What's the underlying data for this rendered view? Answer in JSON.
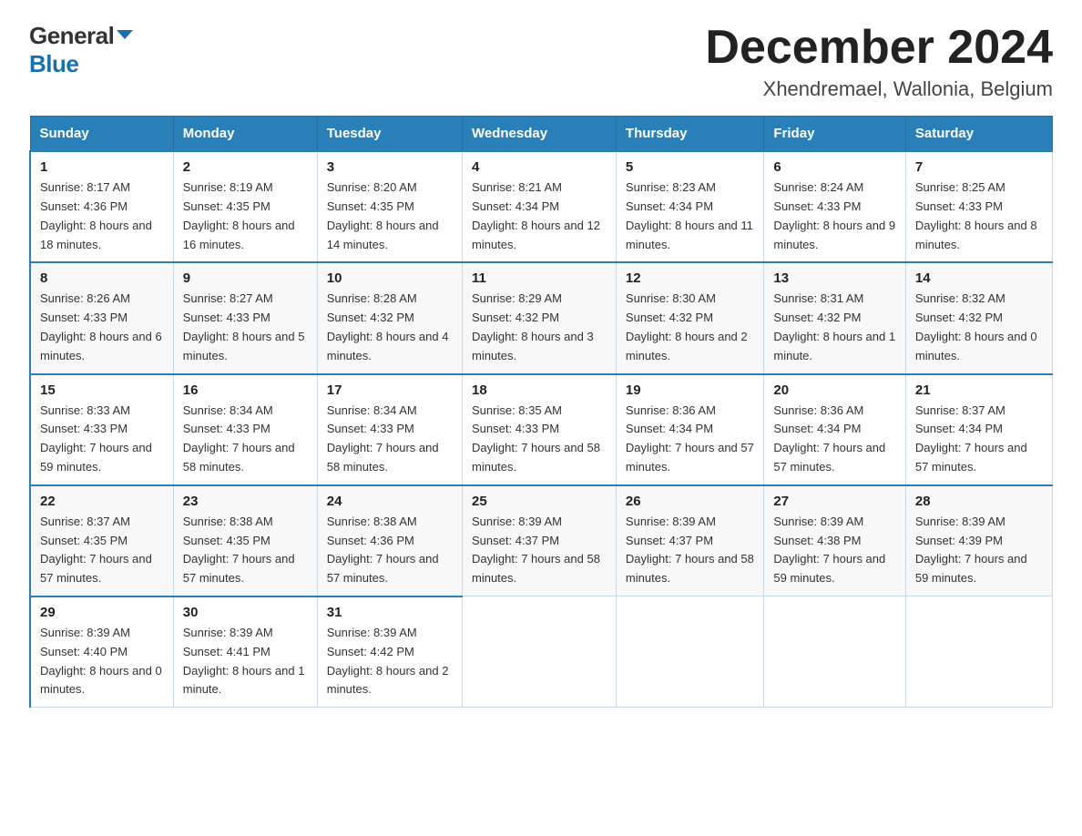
{
  "header": {
    "logo_general": "General",
    "logo_blue": "Blue",
    "month_title": "December 2024",
    "location": "Xhendremael, Wallonia, Belgium"
  },
  "columns": [
    "Sunday",
    "Monday",
    "Tuesday",
    "Wednesday",
    "Thursday",
    "Friday",
    "Saturday"
  ],
  "weeks": [
    [
      {
        "day": "1",
        "sunrise": "Sunrise: 8:17 AM",
        "sunset": "Sunset: 4:36 PM",
        "daylight": "Daylight: 8 hours and 18 minutes."
      },
      {
        "day": "2",
        "sunrise": "Sunrise: 8:19 AM",
        "sunset": "Sunset: 4:35 PM",
        "daylight": "Daylight: 8 hours and 16 minutes."
      },
      {
        "day": "3",
        "sunrise": "Sunrise: 8:20 AM",
        "sunset": "Sunset: 4:35 PM",
        "daylight": "Daylight: 8 hours and 14 minutes."
      },
      {
        "day": "4",
        "sunrise": "Sunrise: 8:21 AM",
        "sunset": "Sunset: 4:34 PM",
        "daylight": "Daylight: 8 hours and 12 minutes."
      },
      {
        "day": "5",
        "sunrise": "Sunrise: 8:23 AM",
        "sunset": "Sunset: 4:34 PM",
        "daylight": "Daylight: 8 hours and 11 minutes."
      },
      {
        "day": "6",
        "sunrise": "Sunrise: 8:24 AM",
        "sunset": "Sunset: 4:33 PM",
        "daylight": "Daylight: 8 hours and 9 minutes."
      },
      {
        "day": "7",
        "sunrise": "Sunrise: 8:25 AM",
        "sunset": "Sunset: 4:33 PM",
        "daylight": "Daylight: 8 hours and 8 minutes."
      }
    ],
    [
      {
        "day": "8",
        "sunrise": "Sunrise: 8:26 AM",
        "sunset": "Sunset: 4:33 PM",
        "daylight": "Daylight: 8 hours and 6 minutes."
      },
      {
        "day": "9",
        "sunrise": "Sunrise: 8:27 AM",
        "sunset": "Sunset: 4:33 PM",
        "daylight": "Daylight: 8 hours and 5 minutes."
      },
      {
        "day": "10",
        "sunrise": "Sunrise: 8:28 AM",
        "sunset": "Sunset: 4:32 PM",
        "daylight": "Daylight: 8 hours and 4 minutes."
      },
      {
        "day": "11",
        "sunrise": "Sunrise: 8:29 AM",
        "sunset": "Sunset: 4:32 PM",
        "daylight": "Daylight: 8 hours and 3 minutes."
      },
      {
        "day": "12",
        "sunrise": "Sunrise: 8:30 AM",
        "sunset": "Sunset: 4:32 PM",
        "daylight": "Daylight: 8 hours and 2 minutes."
      },
      {
        "day": "13",
        "sunrise": "Sunrise: 8:31 AM",
        "sunset": "Sunset: 4:32 PM",
        "daylight": "Daylight: 8 hours and 1 minute."
      },
      {
        "day": "14",
        "sunrise": "Sunrise: 8:32 AM",
        "sunset": "Sunset: 4:32 PM",
        "daylight": "Daylight: 8 hours and 0 minutes."
      }
    ],
    [
      {
        "day": "15",
        "sunrise": "Sunrise: 8:33 AM",
        "sunset": "Sunset: 4:33 PM",
        "daylight": "Daylight: 7 hours and 59 minutes."
      },
      {
        "day": "16",
        "sunrise": "Sunrise: 8:34 AM",
        "sunset": "Sunset: 4:33 PM",
        "daylight": "Daylight: 7 hours and 58 minutes."
      },
      {
        "day": "17",
        "sunrise": "Sunrise: 8:34 AM",
        "sunset": "Sunset: 4:33 PM",
        "daylight": "Daylight: 7 hours and 58 minutes."
      },
      {
        "day": "18",
        "sunrise": "Sunrise: 8:35 AM",
        "sunset": "Sunset: 4:33 PM",
        "daylight": "Daylight: 7 hours and 58 minutes."
      },
      {
        "day": "19",
        "sunrise": "Sunrise: 8:36 AM",
        "sunset": "Sunset: 4:34 PM",
        "daylight": "Daylight: 7 hours and 57 minutes."
      },
      {
        "day": "20",
        "sunrise": "Sunrise: 8:36 AM",
        "sunset": "Sunset: 4:34 PM",
        "daylight": "Daylight: 7 hours and 57 minutes."
      },
      {
        "day": "21",
        "sunrise": "Sunrise: 8:37 AM",
        "sunset": "Sunset: 4:34 PM",
        "daylight": "Daylight: 7 hours and 57 minutes."
      }
    ],
    [
      {
        "day": "22",
        "sunrise": "Sunrise: 8:37 AM",
        "sunset": "Sunset: 4:35 PM",
        "daylight": "Daylight: 7 hours and 57 minutes."
      },
      {
        "day": "23",
        "sunrise": "Sunrise: 8:38 AM",
        "sunset": "Sunset: 4:35 PM",
        "daylight": "Daylight: 7 hours and 57 minutes."
      },
      {
        "day": "24",
        "sunrise": "Sunrise: 8:38 AM",
        "sunset": "Sunset: 4:36 PM",
        "daylight": "Daylight: 7 hours and 57 minutes."
      },
      {
        "day": "25",
        "sunrise": "Sunrise: 8:39 AM",
        "sunset": "Sunset: 4:37 PM",
        "daylight": "Daylight: 7 hours and 58 minutes."
      },
      {
        "day": "26",
        "sunrise": "Sunrise: 8:39 AM",
        "sunset": "Sunset: 4:37 PM",
        "daylight": "Daylight: 7 hours and 58 minutes."
      },
      {
        "day": "27",
        "sunrise": "Sunrise: 8:39 AM",
        "sunset": "Sunset: 4:38 PM",
        "daylight": "Daylight: 7 hours and 59 minutes."
      },
      {
        "day": "28",
        "sunrise": "Sunrise: 8:39 AM",
        "sunset": "Sunset: 4:39 PM",
        "daylight": "Daylight: 7 hours and 59 minutes."
      }
    ],
    [
      {
        "day": "29",
        "sunrise": "Sunrise: 8:39 AM",
        "sunset": "Sunset: 4:40 PM",
        "daylight": "Daylight: 8 hours and 0 minutes."
      },
      {
        "day": "30",
        "sunrise": "Sunrise: 8:39 AM",
        "sunset": "Sunset: 4:41 PM",
        "daylight": "Daylight: 8 hours and 1 minute."
      },
      {
        "day": "31",
        "sunrise": "Sunrise: 8:39 AM",
        "sunset": "Sunset: 4:42 PM",
        "daylight": "Daylight: 8 hours and 2 minutes."
      },
      null,
      null,
      null,
      null
    ]
  ]
}
